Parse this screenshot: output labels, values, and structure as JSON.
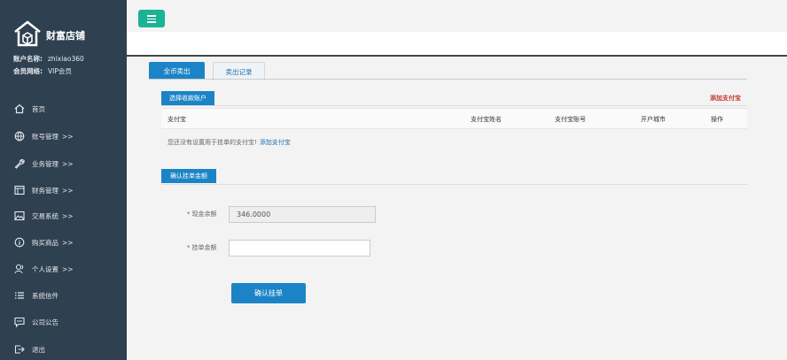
{
  "brand": {
    "name": "财富店铺"
  },
  "account": {
    "name_label": "账户名称:",
    "name_value": "zhixiao360",
    "level_label": "会员网络:",
    "level_value": "VIP会员"
  },
  "sidebar": {
    "items": [
      {
        "label": "首页",
        "arrow": "",
        "icon": "home-icon"
      },
      {
        "label": "账号管理",
        "arrow": ">>",
        "icon": "globe-icon"
      },
      {
        "label": "业务管理",
        "arrow": ">>",
        "icon": "wrench-icon"
      },
      {
        "label": "财务管理",
        "arrow": ">>",
        "icon": "window-icon"
      },
      {
        "label": "交易系统",
        "arrow": ">>",
        "icon": "image-icon"
      },
      {
        "label": "购买商品",
        "arrow": ">>",
        "icon": "info-icon"
      },
      {
        "label": "个人设置",
        "arrow": ">>",
        "icon": "user-icon"
      },
      {
        "label": "系统信件",
        "arrow": "",
        "icon": "list-icon"
      },
      {
        "label": "公司公告",
        "arrow": "",
        "icon": "comment-icon"
      },
      {
        "label": "退出",
        "arrow": "",
        "icon": "logout-icon"
      }
    ]
  },
  "tabs": [
    {
      "label": "全币卖出",
      "active": true
    },
    {
      "label": "卖出记录",
      "active": false
    }
  ],
  "section_receiver": {
    "title": "选择收款账户",
    "add_link": "添加支付宝",
    "columns": [
      "支付宝",
      "支付宝姓名",
      "支付宝账号",
      "开户城市",
      "操作"
    ],
    "notice": "您还没有设置用于挂单的支付宝!",
    "notice_link": "添加支付宝"
  },
  "section_amount": {
    "title": "确认挂单金额",
    "balance_label": "现金余额",
    "balance_value": "346.0000",
    "amount_label": "挂单金额",
    "amount_value": "",
    "submit_label": "确认挂单"
  },
  "colors": {
    "sidebar_bg": "#2f4050",
    "primary": "#1c84c6",
    "menu_button": "#1ab394",
    "danger": "#c0392b"
  }
}
